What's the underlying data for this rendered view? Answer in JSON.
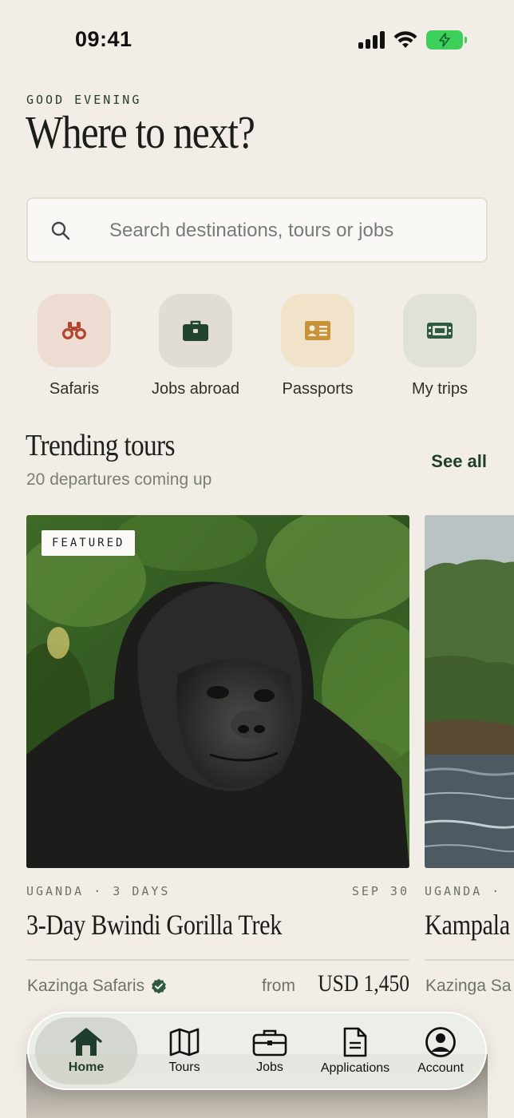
{
  "status_bar": {
    "time": "09:41"
  },
  "header": {
    "greeting": "GOOD EVENING",
    "headline": "Where to next?"
  },
  "search": {
    "placeholder": "Search destinations, tours or jobs"
  },
  "categories": [
    {
      "label": "Safaris",
      "icon": "binoculars-icon",
      "tile_color": "#ecdcd2",
      "icon_color": "#b5452e"
    },
    {
      "label": "Jobs abroad",
      "icon": "briefcase-icon",
      "tile_color": "#e1ddd4",
      "icon_color": "#21432f"
    },
    {
      "label": "Passports",
      "icon": "id-card-icon",
      "tile_color": "#f1e3c9",
      "icon_color": "#c8923a"
    },
    {
      "label": "My trips",
      "icon": "ticket-icon",
      "tile_color": "#e0e1d9",
      "icon_color": "#2e5a43"
    }
  ],
  "trending": {
    "title": "Trending tours",
    "subtitle": "20 departures coming up",
    "see_all": "See all"
  },
  "tours": [
    {
      "badge": "FEATURED",
      "meta_left": "UGANDA · 3 DAYS",
      "meta_right": "SEP 30",
      "title": "3-Day Bwindi Gorilla Trek",
      "operator": "Kazinga Safaris",
      "price_prefix": "from",
      "price": "USD 1,450"
    },
    {
      "meta_left": "UGANDA ·",
      "title": "Kampala",
      "operator": "Kazinga Sa"
    }
  ],
  "tabbar": {
    "tabs": [
      {
        "label": "Home",
        "icon": "home-icon",
        "active": true
      },
      {
        "label": "Tours",
        "icon": "map-icon",
        "active": false
      },
      {
        "label": "Jobs",
        "icon": "briefcase-icon",
        "active": false
      },
      {
        "label": "Applications",
        "icon": "document-icon",
        "active": false
      },
      {
        "label": "Account",
        "icon": "user-circle-icon",
        "active": false
      }
    ]
  },
  "colors": {
    "background": "#f2eee7",
    "accent": "#1f3d2d",
    "verified": "#2f5a40"
  }
}
